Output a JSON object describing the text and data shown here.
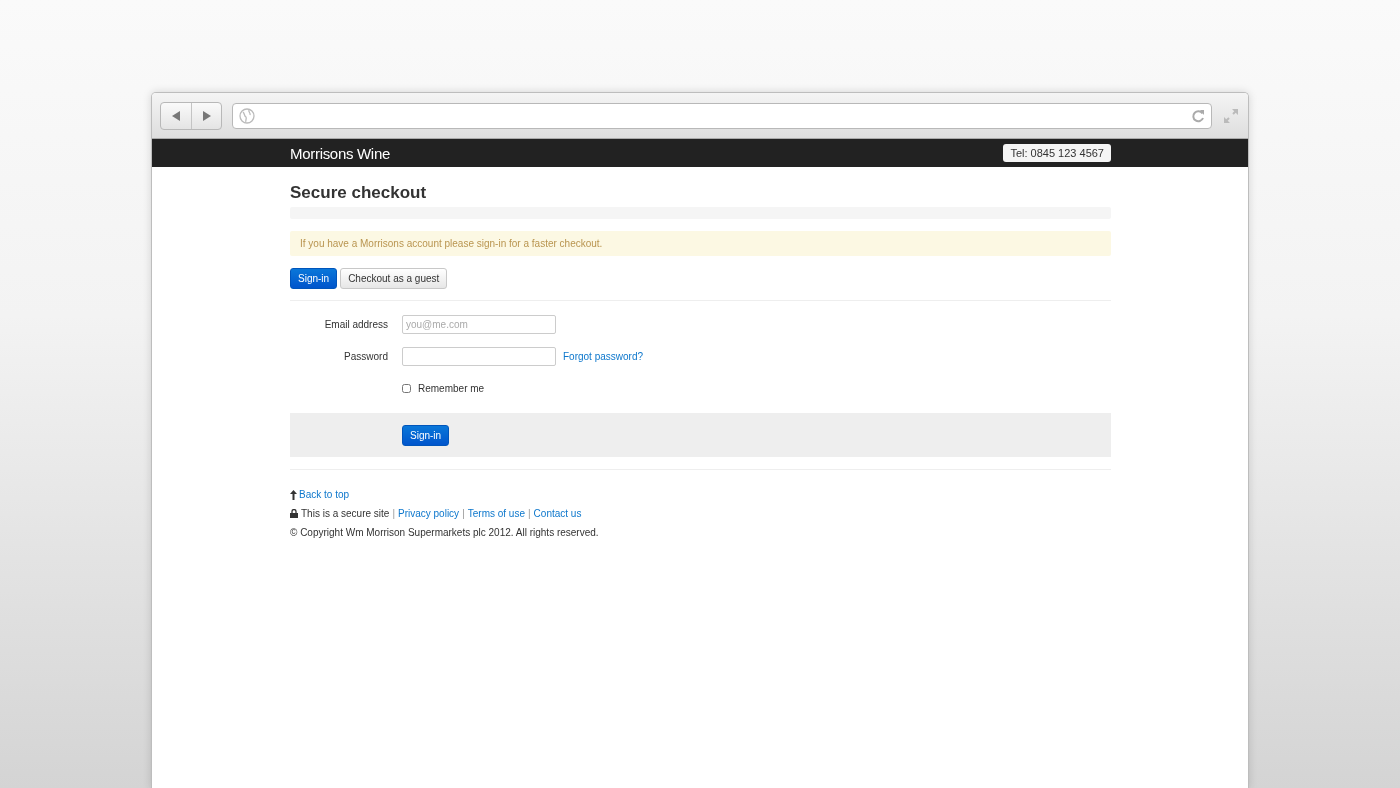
{
  "site": {
    "brand": "Morrisons Wine",
    "phone": "Tel: 0845 123 4567"
  },
  "page": {
    "title": "Secure checkout",
    "notice": "If you have a Morrisons account please sign-in for a faster checkout.",
    "tabs": [
      {
        "label": "Sign-in",
        "selected": true
      },
      {
        "label": "Checkout as a guest",
        "selected": false
      }
    ],
    "form": {
      "email": {
        "label": "Email address",
        "placeholder": "you@me.com"
      },
      "password": {
        "label": "Password",
        "link": "Forgot password?"
      },
      "remember": {
        "label": "Remember me",
        "checked": false
      },
      "submit": "Sign-in"
    }
  },
  "footer": {
    "back_to_top": "Back to top",
    "secure": "This is a secure site",
    "separator": "|",
    "links": [
      "Privacy policy",
      "Terms of use",
      "Contact us"
    ],
    "copyright": "© Copyright Wm Morrison Supermarkets plc 2012. All rights reserved."
  }
}
